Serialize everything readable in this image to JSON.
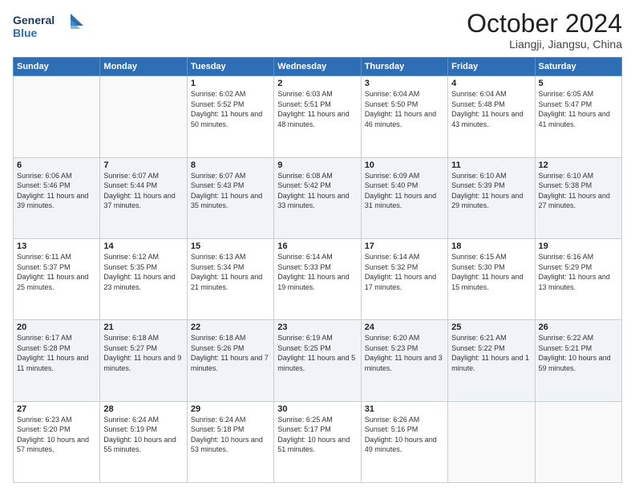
{
  "logo": {
    "line1": "General",
    "line2": "Blue"
  },
  "title": "October 2024",
  "location": "Liangji, Jiangsu, China",
  "weekdays": [
    "Sunday",
    "Monday",
    "Tuesday",
    "Wednesday",
    "Thursday",
    "Friday",
    "Saturday"
  ],
  "weeks": [
    [
      {
        "day": "",
        "sunrise": "",
        "sunset": "",
        "daylight": ""
      },
      {
        "day": "",
        "sunrise": "",
        "sunset": "",
        "daylight": ""
      },
      {
        "day": "1",
        "sunrise": "Sunrise: 6:02 AM",
        "sunset": "Sunset: 5:52 PM",
        "daylight": "Daylight: 11 hours and 50 minutes."
      },
      {
        "day": "2",
        "sunrise": "Sunrise: 6:03 AM",
        "sunset": "Sunset: 5:51 PM",
        "daylight": "Daylight: 11 hours and 48 minutes."
      },
      {
        "day": "3",
        "sunrise": "Sunrise: 6:04 AM",
        "sunset": "Sunset: 5:50 PM",
        "daylight": "Daylight: 11 hours and 46 minutes."
      },
      {
        "day": "4",
        "sunrise": "Sunrise: 6:04 AM",
        "sunset": "Sunset: 5:48 PM",
        "daylight": "Daylight: 11 hours and 43 minutes."
      },
      {
        "day": "5",
        "sunrise": "Sunrise: 6:05 AM",
        "sunset": "Sunset: 5:47 PM",
        "daylight": "Daylight: 11 hours and 41 minutes."
      }
    ],
    [
      {
        "day": "6",
        "sunrise": "Sunrise: 6:06 AM",
        "sunset": "Sunset: 5:46 PM",
        "daylight": "Daylight: 11 hours and 39 minutes."
      },
      {
        "day": "7",
        "sunrise": "Sunrise: 6:07 AM",
        "sunset": "Sunset: 5:44 PM",
        "daylight": "Daylight: 11 hours and 37 minutes."
      },
      {
        "day": "8",
        "sunrise": "Sunrise: 6:07 AM",
        "sunset": "Sunset: 5:43 PM",
        "daylight": "Daylight: 11 hours and 35 minutes."
      },
      {
        "day": "9",
        "sunrise": "Sunrise: 6:08 AM",
        "sunset": "Sunset: 5:42 PM",
        "daylight": "Daylight: 11 hours and 33 minutes."
      },
      {
        "day": "10",
        "sunrise": "Sunrise: 6:09 AM",
        "sunset": "Sunset: 5:40 PM",
        "daylight": "Daylight: 11 hours and 31 minutes."
      },
      {
        "day": "11",
        "sunrise": "Sunrise: 6:10 AM",
        "sunset": "Sunset: 5:39 PM",
        "daylight": "Daylight: 11 hours and 29 minutes."
      },
      {
        "day": "12",
        "sunrise": "Sunrise: 6:10 AM",
        "sunset": "Sunset: 5:38 PM",
        "daylight": "Daylight: 11 hours and 27 minutes."
      }
    ],
    [
      {
        "day": "13",
        "sunrise": "Sunrise: 6:11 AM",
        "sunset": "Sunset: 5:37 PM",
        "daylight": "Daylight: 11 hours and 25 minutes."
      },
      {
        "day": "14",
        "sunrise": "Sunrise: 6:12 AM",
        "sunset": "Sunset: 5:35 PM",
        "daylight": "Daylight: 11 hours and 23 minutes."
      },
      {
        "day": "15",
        "sunrise": "Sunrise: 6:13 AM",
        "sunset": "Sunset: 5:34 PM",
        "daylight": "Daylight: 11 hours and 21 minutes."
      },
      {
        "day": "16",
        "sunrise": "Sunrise: 6:14 AM",
        "sunset": "Sunset: 5:33 PM",
        "daylight": "Daylight: 11 hours and 19 minutes."
      },
      {
        "day": "17",
        "sunrise": "Sunrise: 6:14 AM",
        "sunset": "Sunset: 5:32 PM",
        "daylight": "Daylight: 11 hours and 17 minutes."
      },
      {
        "day": "18",
        "sunrise": "Sunrise: 6:15 AM",
        "sunset": "Sunset: 5:30 PM",
        "daylight": "Daylight: 11 hours and 15 minutes."
      },
      {
        "day": "19",
        "sunrise": "Sunrise: 6:16 AM",
        "sunset": "Sunset: 5:29 PM",
        "daylight": "Daylight: 11 hours and 13 minutes."
      }
    ],
    [
      {
        "day": "20",
        "sunrise": "Sunrise: 6:17 AM",
        "sunset": "Sunset: 5:28 PM",
        "daylight": "Daylight: 11 hours and 11 minutes."
      },
      {
        "day": "21",
        "sunrise": "Sunrise: 6:18 AM",
        "sunset": "Sunset: 5:27 PM",
        "daylight": "Daylight: 11 hours and 9 minutes."
      },
      {
        "day": "22",
        "sunrise": "Sunrise: 6:18 AM",
        "sunset": "Sunset: 5:26 PM",
        "daylight": "Daylight: 11 hours and 7 minutes."
      },
      {
        "day": "23",
        "sunrise": "Sunrise: 6:19 AM",
        "sunset": "Sunset: 5:25 PM",
        "daylight": "Daylight: 11 hours and 5 minutes."
      },
      {
        "day": "24",
        "sunrise": "Sunrise: 6:20 AM",
        "sunset": "Sunset: 5:23 PM",
        "daylight": "Daylight: 11 hours and 3 minutes."
      },
      {
        "day": "25",
        "sunrise": "Sunrise: 6:21 AM",
        "sunset": "Sunset: 5:22 PM",
        "daylight": "Daylight: 11 hours and 1 minute."
      },
      {
        "day": "26",
        "sunrise": "Sunrise: 6:22 AM",
        "sunset": "Sunset: 5:21 PM",
        "daylight": "Daylight: 10 hours and 59 minutes."
      }
    ],
    [
      {
        "day": "27",
        "sunrise": "Sunrise: 6:23 AM",
        "sunset": "Sunset: 5:20 PM",
        "daylight": "Daylight: 10 hours and 57 minutes."
      },
      {
        "day": "28",
        "sunrise": "Sunrise: 6:24 AM",
        "sunset": "Sunset: 5:19 PM",
        "daylight": "Daylight: 10 hours and 55 minutes."
      },
      {
        "day": "29",
        "sunrise": "Sunrise: 6:24 AM",
        "sunset": "Sunset: 5:18 PM",
        "daylight": "Daylight: 10 hours and 53 minutes."
      },
      {
        "day": "30",
        "sunrise": "Sunrise: 6:25 AM",
        "sunset": "Sunset: 5:17 PM",
        "daylight": "Daylight: 10 hours and 51 minutes."
      },
      {
        "day": "31",
        "sunrise": "Sunrise: 6:26 AM",
        "sunset": "Sunset: 5:16 PM",
        "daylight": "Daylight: 10 hours and 49 minutes."
      },
      {
        "day": "",
        "sunrise": "",
        "sunset": "",
        "daylight": ""
      },
      {
        "day": "",
        "sunrise": "",
        "sunset": "",
        "daylight": ""
      }
    ]
  ]
}
